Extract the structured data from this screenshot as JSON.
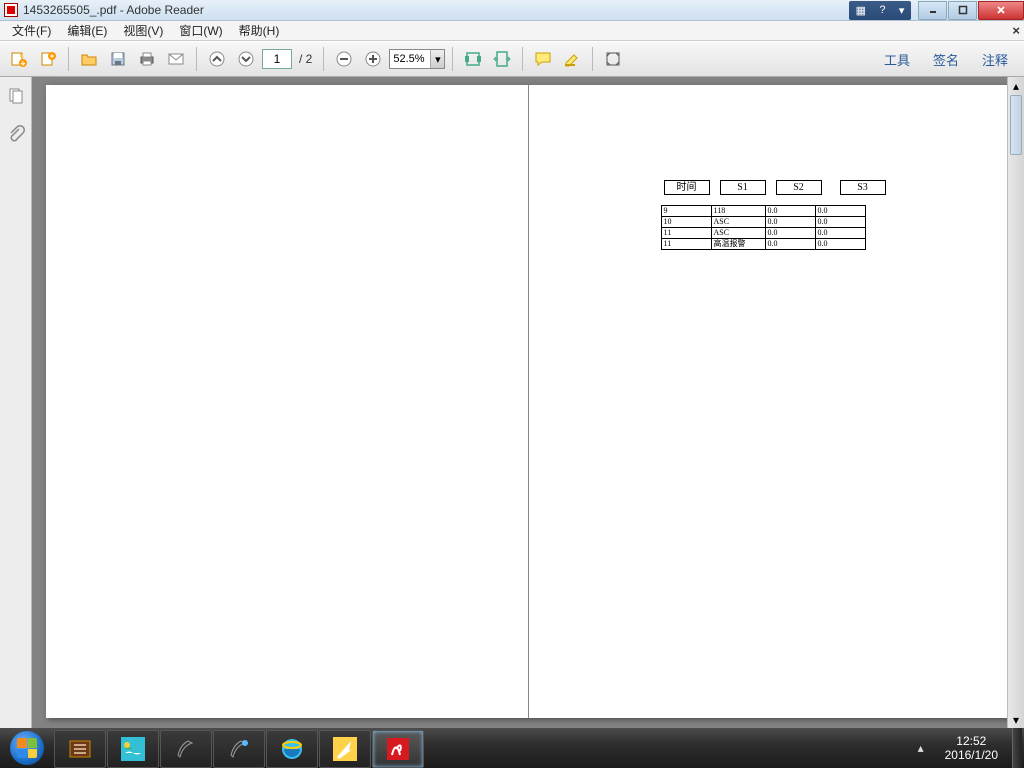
{
  "window": {
    "title": "1453265505_.pdf - Adobe Reader"
  },
  "menu": {
    "file": "文件(F)",
    "edit": "编辑(E)",
    "view": "视图(V)",
    "window": "窗口(W)",
    "help": "帮助(H)",
    "close_x": "×"
  },
  "toolbar": {
    "page_current": "1",
    "page_total": "/ 2",
    "zoom": "52.5%",
    "right": {
      "tools": "工具",
      "sign": "签名",
      "comment": "注释"
    }
  },
  "doc": {
    "headers": [
      "时间",
      "S1",
      "S2",
      "S3"
    ],
    "rows": [
      [
        "9",
        "118",
        "0.0",
        "0.0"
      ],
      [
        "10",
        "ASC",
        "0.0",
        "0.0"
      ],
      [
        "11",
        "ASC",
        "0.0",
        "0.0"
      ],
      [
        "11",
        "高温报警",
        "0.0",
        "0.0"
      ]
    ]
  },
  "tray": {
    "time": "12:52",
    "date": "2016/1/20"
  }
}
